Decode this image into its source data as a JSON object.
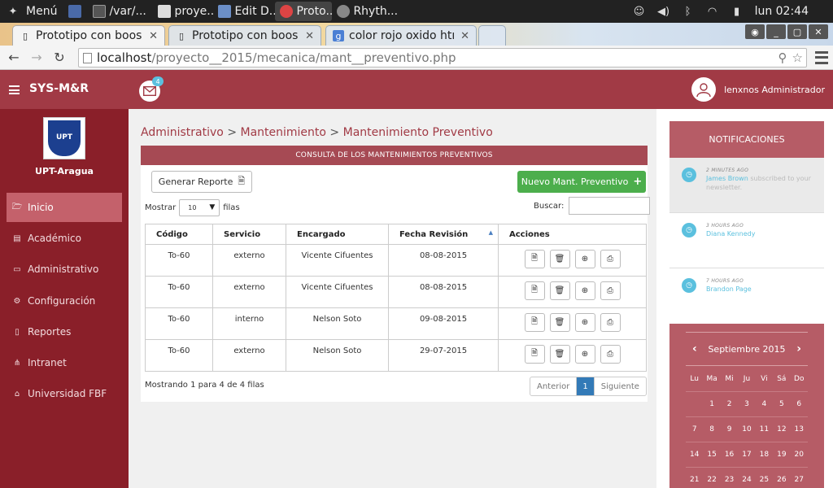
{
  "os": {
    "menu_label": "Menú",
    "tasks": [
      "/var/...",
      "proye...",
      "Edit D...",
      "Proto...",
      "Rhyth..."
    ],
    "clock": "lun 02:44"
  },
  "browser": {
    "tabs": [
      {
        "title": "Prototipo con boos",
        "active": true
      },
      {
        "title": "Prototipo con boos",
        "active": false
      },
      {
        "title": "color rojo oxido htı",
        "active": false
      }
    ],
    "url_host": "localhost",
    "url_path": "/proyecto__2015/mecanica/mant__preventivo.php"
  },
  "header": {
    "brand": "SYS-M&R",
    "mail_count": "4",
    "user_name": "lenxnos Administrador"
  },
  "sidebar": {
    "logo_text": "UPT",
    "campus": "UPT-Aragua",
    "items": [
      {
        "label": "Inicio",
        "icon": "folder-open-icon",
        "active": true
      },
      {
        "label": "Académico",
        "icon": "book-icon",
        "active": false
      },
      {
        "label": "Administrativo",
        "icon": "desktop-icon",
        "active": false
      },
      {
        "label": "Configuración",
        "icon": "cogs-icon",
        "active": false
      },
      {
        "label": "Reportes",
        "icon": "file-text-icon",
        "active": false
      },
      {
        "label": "Intranet",
        "icon": "sitemap-icon",
        "active": false
      },
      {
        "label": "Universidad FBF",
        "icon": "university-icon",
        "active": false
      }
    ]
  },
  "breadcrumb": [
    "Administrativo",
    "Mantenimiento",
    "Mantenimiento Preventivo"
  ],
  "panel": {
    "title": "CONSULTA DE LOS MANTENIMIENTOS PREVENTIVOS",
    "report_button": "Generar Reporte",
    "new_button": "Nuevo Mant. Preventivo",
    "show_label": "Mostrar",
    "show_value": "10",
    "rows_label": "filas",
    "search_label": "Buscar:",
    "columns": [
      "Código",
      "Servicio",
      "Encargado",
      "Fecha Revisión",
      "Acciones"
    ],
    "rows": [
      {
        "codigo": "To-60",
        "servicio": "externo",
        "encargado": "Vicente Cifuentes",
        "fecha": "08-08-2015"
      },
      {
        "codigo": "To-60",
        "servicio": "externo",
        "encargado": "Vicente Cifuentes",
        "fecha": "08-08-2015"
      },
      {
        "codigo": "To-60",
        "servicio": "interno",
        "encargado": "Nelson Soto",
        "fecha": "09-08-2015"
      },
      {
        "codigo": "To-60",
        "servicio": "externo",
        "encargado": "Nelson Soto",
        "fecha": "29-07-2015"
      }
    ],
    "info": "Mostrando 1 para 4 de 4 filas",
    "pager": {
      "prev": "Anterior",
      "current": "1",
      "next": "Siguiente"
    }
  },
  "notifications": {
    "title": "NOTIFICACIONES",
    "items": [
      {
        "when": "2 MINUTES AGO",
        "who": "James Brown",
        "action": "subscribed to your newsletter."
      },
      {
        "when": "3 HOURS AGO",
        "who": "Diana Kennedy",
        "action": ""
      },
      {
        "when": "7 HOURS AGO",
        "who": "Brandon Page",
        "action": ""
      }
    ]
  },
  "calendar": {
    "month": "Septiembre 2015",
    "weekdays": [
      "Lu",
      "Ma",
      "Mi",
      "Ju",
      "Vi",
      "Sá",
      "Do"
    ],
    "weeks": [
      [
        "",
        "1",
        "2",
        "3",
        "4",
        "5",
        "6"
      ],
      [
        "7",
        "8",
        "9",
        "10",
        "11",
        "12",
        "13"
      ],
      [
        "14",
        "15",
        "16",
        "17",
        "18",
        "19",
        "20"
      ],
      [
        "21",
        "22",
        "23",
        "24",
        "25",
        "26",
        "27"
      ]
    ]
  },
  "colors": {
    "brand": "#a13a45",
    "sidebar": "#8a1f29",
    "success": "#4cae4c",
    "info": "#5bc0de",
    "primary": "#337ab7"
  }
}
